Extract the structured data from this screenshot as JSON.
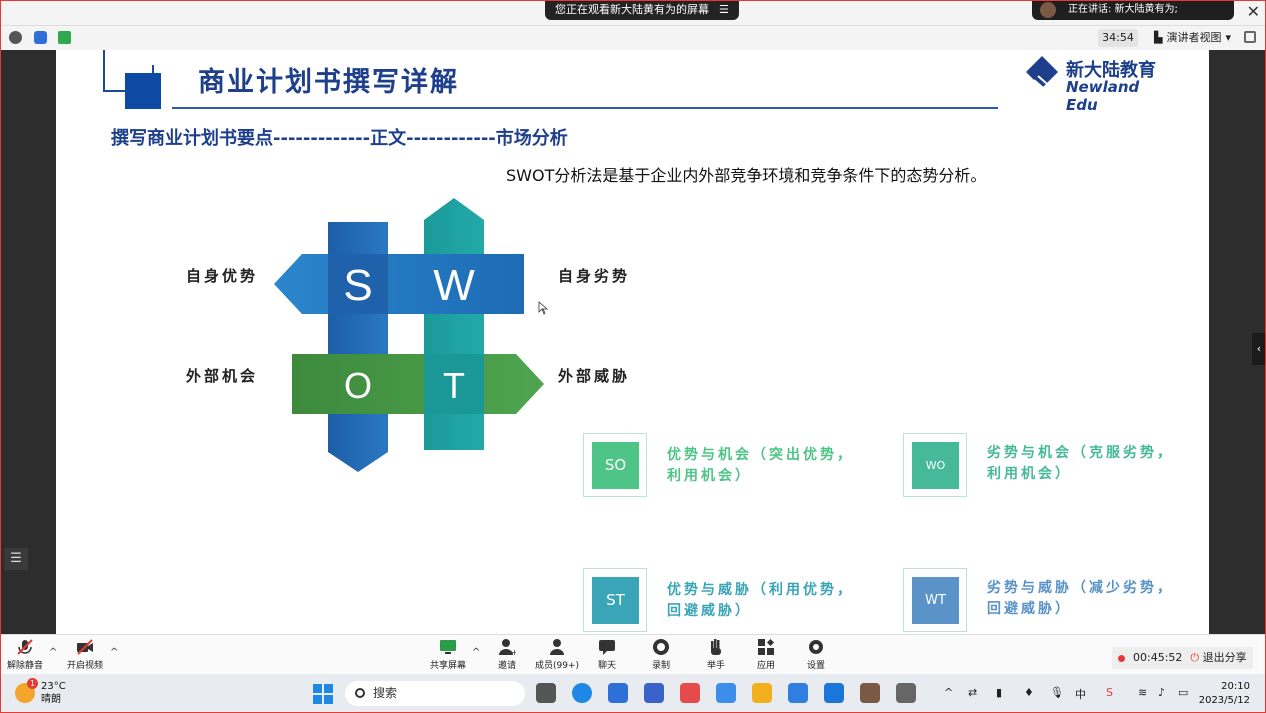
{
  "meeting": {
    "share_banner": "您正在观看新大陆黄有为的屏幕",
    "speaking": "正在讲话: 新大陆黄有为;",
    "timer": "34:54",
    "view_mode": "演讲者视图",
    "record_time": "00:45:52",
    "stop_share": "退出分享"
  },
  "toolbar": {
    "mute": "解除静音",
    "video": "开启视频",
    "share": "共享屏幕",
    "invite": "邀请",
    "members": "成员(99+)",
    "chat": "聊天",
    "record": "录制",
    "raise_hand": "举手",
    "apps": "应用",
    "settings": "设置"
  },
  "slide": {
    "title": "商业计划书撰写详解",
    "logo_cn": "新大陆教育",
    "logo_en": "Newland Edu",
    "subtitle": "撰写商业计划书要点-------------正文------------市场分析",
    "description": "SWOT分析法是基于企业内外部竞争环境和竞争条件下的态势分析。",
    "swot_letters": {
      "s": "S",
      "w": "W",
      "o": "O",
      "t": "T"
    },
    "labels": {
      "strength": "自身优势",
      "weakness": "自身劣势",
      "opportunity": "外部机会",
      "threat": "外部威胁"
    },
    "strategies": [
      {
        "code": "SO",
        "text": "优势与机会（突出优势，利用机会）",
        "color": "#4ec486"
      },
      {
        "code": "WO",
        "text": "劣势与机会（克服劣势，利用机会）",
        "color": "#45b99a"
      },
      {
        "code": "ST",
        "text": "优势与威胁（利用优势，回避威胁）",
        "color": "#3ba5b8"
      },
      {
        "code": "WT",
        "text": "劣势与威胁（减少劣势，回避威胁）",
        "color": "#5a93c8"
      }
    ]
  },
  "taskbar": {
    "temperature": "23°C",
    "weather": "晴朗",
    "notif_count": "1",
    "search": "搜索",
    "ime": "中",
    "time": "20:10",
    "date": "2023/5/12"
  }
}
